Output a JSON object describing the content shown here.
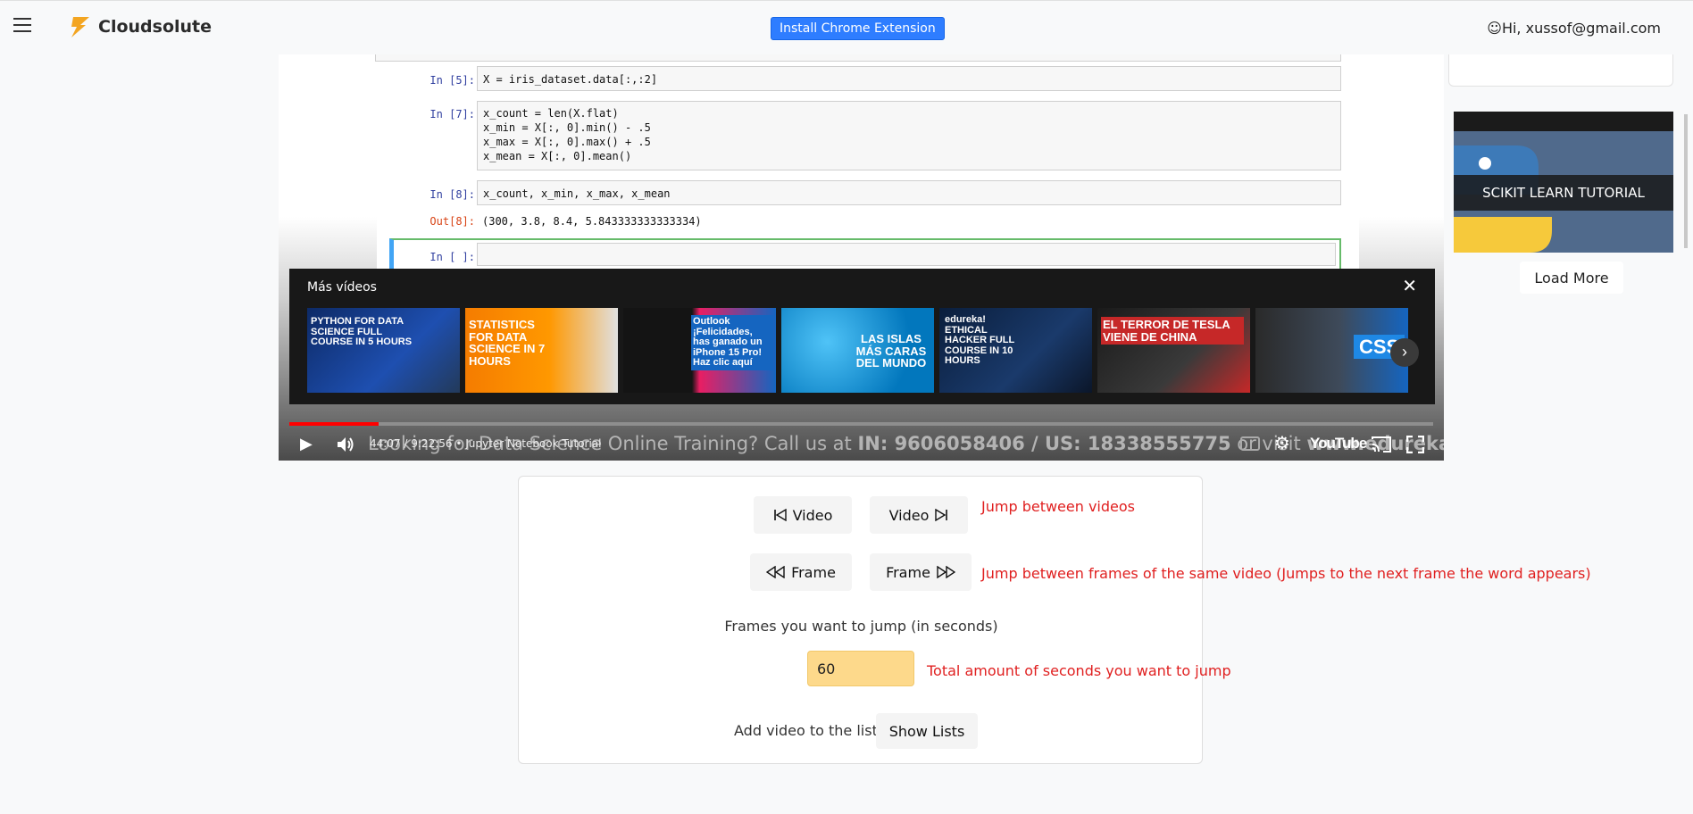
{
  "header": {
    "brand": "Cloudsolute",
    "extension_button": "Install Chrome Extension",
    "user_greeting": "☺Hi, xussof@gmail.com"
  },
  "player": {
    "notebook": {
      "cells": [
        {
          "prompt": "In [5]:",
          "code": "X = iris_dataset.data[:,:2]"
        },
        {
          "prompt": "In [7]:",
          "code": "x_count = len(X.flat)\nx_min = X[:, 0].min() - .5\nx_max = X[:, 0].max() + .5\nx_mean = X[:, 0].mean()"
        },
        {
          "prompt": "In [8]:",
          "code": "x_count, x_min, x_max, x_mean"
        },
        {
          "prompt": "Out[8]:",
          "output": "(300, 3.8, 8.4, 5.843333333333334)"
        },
        {
          "prompt": "In [ ]:",
          "code": ""
        }
      ]
    },
    "more_videos": {
      "title": "Más vídeos",
      "thumbs": [
        {
          "caption": "PYTHON FOR DATA SCIENCE FULL COURSE IN 5 HOURS"
        },
        {
          "caption": "STATISTICS FOR DATA SCIENCE IN 7 HOURS"
        },
        {
          "caption": "Outlook ¡Felicidades, has ganado un iPhone 15 Pro! Haz clic aquí"
        },
        {
          "caption": "LAS ISLAS MÁS CARAS DEL MUNDO"
        },
        {
          "caption": "edureka! ETHICAL HACKER FULL COURSE IN 10 HOURS"
        },
        {
          "caption": "EL TERROR DE TESLA VIENE DE CHINA"
        },
        {
          "caption": "CSS"
        }
      ]
    },
    "progress": 0.078,
    "time": "44:07 / 9:22:56 • Jupyter Notebook Tutorial",
    "ticker": {
      "lead": "Looking for Data Science Online Training? Call us at ",
      "phones": "IN: 9606058406 / US: 18338555775",
      "trail": " or visit ",
      "site": "www.edureka.co"
    },
    "youtube_logo": "YouTube"
  },
  "sidebar": {
    "video_title": "SCIKIT LEARN TUTORIAL",
    "load_more": "Load More"
  },
  "panel": {
    "prev_video": "Video",
    "next_video": "Video",
    "video_hint": "Jump between videos",
    "prev_frame": "Frame",
    "next_frame": "Frame",
    "frame_hint": "Jump between frames of the same video (Jumps to the next frame the word appears)",
    "jump_label": "Frames you want to jump (in seconds)",
    "seconds_value": "60",
    "seconds_hint": "Total amount of seconds you want to jump",
    "list_label": "Add video to the list:",
    "show_lists": "Show Lists"
  },
  "colors": {
    "accent": "#2e7dff",
    "hint": "#e02020",
    "seconds_input": "#fdd98b",
    "progress": "#ff0000"
  }
}
